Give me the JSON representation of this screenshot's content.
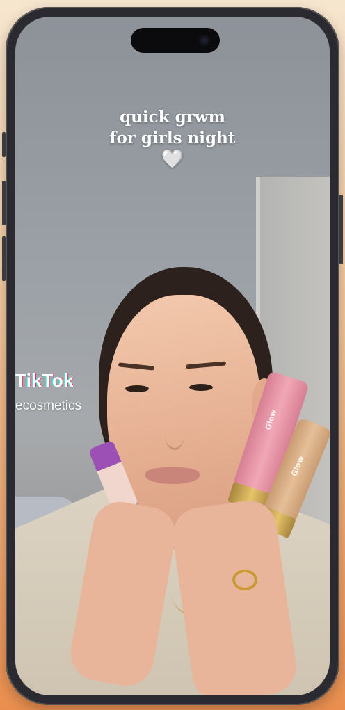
{
  "video": {
    "caption_line1": "quick grwm",
    "caption_line2": "for girls night",
    "caption_emoji": "🤍"
  },
  "watermark": {
    "logo": "TikTok",
    "handle": "ecosmetics"
  },
  "products": {
    "pink_tube_label": "Glow",
    "tan_tube_label": "Glow"
  },
  "icons": {
    "camera": "front-camera-icon",
    "heart": "heart-icon"
  },
  "colors": {
    "background_top": "#f7e6cf",
    "background_bottom": "#e98e4f",
    "phone_frame": "#2a2a30",
    "caption_text": "#ffffff"
  }
}
